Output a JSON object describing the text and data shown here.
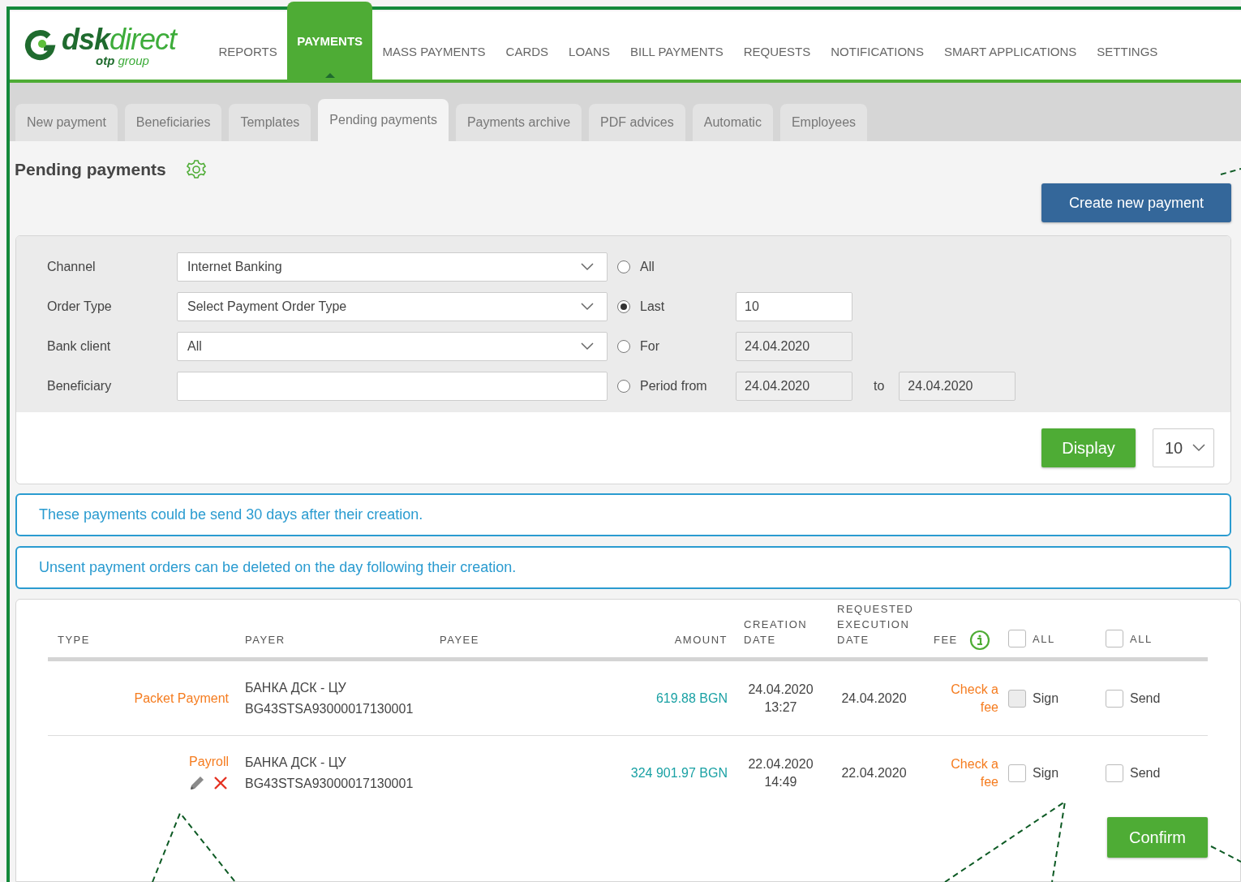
{
  "logo": {
    "name": "**dsk**direct",
    "tagline": "**otp** group"
  },
  "nav": [
    {
      "label": "REPORTS",
      "selected": false
    },
    {
      "label": "PAYMENTS",
      "selected": true
    },
    {
      "label": "MASS PAYMENTS",
      "selected": false
    },
    {
      "label": "CARDS",
      "selected": false
    },
    {
      "label": "LOANS",
      "selected": false
    },
    {
      "label": "BILL PAYMENTS",
      "selected": false
    },
    {
      "label": "REQUESTS",
      "selected": false
    },
    {
      "label": "NOTIFICATIONS",
      "selected": false
    },
    {
      "label": "SMART APPLICATIONS",
      "selected": false
    },
    {
      "label": "SETTINGS",
      "selected": false
    }
  ],
  "subtabs": [
    {
      "label": "New payment",
      "selected": false
    },
    {
      "label": "Beneficiaries",
      "selected": false
    },
    {
      "label": "Templates",
      "selected": false
    },
    {
      "label": "Pending payments",
      "selected": true
    },
    {
      "label": "Payments archive",
      "selected": false
    },
    {
      "label": "PDF advices",
      "selected": false
    },
    {
      "label": "Automatic",
      "selected": false
    },
    {
      "label": "Employees",
      "selected": false
    }
  ],
  "page_title": "Pending payments",
  "create_button": "Create new payment",
  "filters": {
    "fields": [
      {
        "label": "Channel",
        "kind": "select",
        "value": "Internet Banking"
      },
      {
        "label": "Order Type",
        "kind": "select",
        "value": "Select Payment Order Type"
      },
      {
        "label": "Bank client",
        "kind": "select",
        "value": "All"
      },
      {
        "label": "Beneficiary",
        "kind": "text"
      }
    ],
    "period": [
      {
        "label": "All",
        "selected": false
      },
      {
        "label": "Last",
        "selected": true,
        "value": "10"
      },
      {
        "label": "For",
        "selected": false,
        "value": "24.04.2020"
      },
      {
        "label": "Period from",
        "selected": false,
        "value": "24.04.2020",
        "to_label": "to",
        "to_value": "24.04.2020"
      }
    ],
    "display_button": "Display",
    "page_size": "10"
  },
  "notices": [
    "These payments could be send 30 days after their creation.",
    "Unsent payment orders can be deleted on the day following their creation."
  ],
  "table": {
    "columns": [
      {
        "label": "TYPE"
      },
      {
        "label": "PAYER"
      },
      {
        "label": "PAYEE"
      },
      {
        "label": "AMOUNT"
      },
      {
        "label": "CREATION\nDATE"
      },
      {
        "label": "REQUESTED\nEXECUTION\nDATE"
      },
      {
        "label": "FEE"
      },
      {
        "label": "ALL",
        "checked": false
      },
      {
        "label": "ALL",
        "checked": false
      }
    ],
    "rows": [
      {
        "type": "Packet Payment",
        "editable": false,
        "payer_name": "БАНКА ДСК - ЦУ",
        "payer_iban": "BG43STSA93000017130001",
        "amount": "619.88 BGN",
        "created_date": "24.04.2020",
        "created_time": "13:27",
        "exec_date": "24.04.2020",
        "fee": "Check a fee",
        "sign_label": "Sign",
        "sign_checked": false,
        "sign_disabled": true,
        "send_label": "Send",
        "send_checked": false
      },
      {
        "type": "Payroll",
        "editable": true,
        "payer_name": "БАНКА ДСК - ЦУ",
        "payer_iban": "BG43STSA93000017130001",
        "amount": "324 901.97 BGN",
        "created_date": "22.04.2020",
        "created_time": "14:49",
        "exec_date": "22.04.2020",
        "fee": "Check a fee",
        "sign_label": "Sign",
        "sign_checked": false,
        "sign_disabled": false,
        "send_label": "Send",
        "send_checked": false
      }
    ],
    "confirm_button": "Confirm"
  }
}
